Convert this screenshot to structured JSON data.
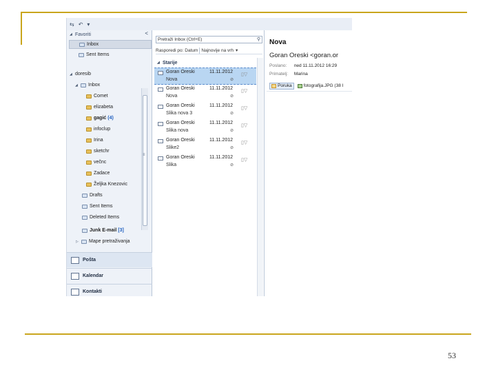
{
  "qat": {
    "icons": [
      "send-receive-icon",
      "undo-icon",
      "customize-icon"
    ],
    "glyphs": [
      "⇆",
      "↶",
      "▾"
    ]
  },
  "nav": {
    "favorites_label": "Favoriti",
    "collapse_glyph": "<",
    "favorites": [
      {
        "label": "Inbox",
        "selected": true
      },
      {
        "label": "Sent Items",
        "selected": false
      }
    ],
    "account_label": "doresib",
    "inbox_label": "Inbox",
    "subfolders": [
      {
        "label": "Comet",
        "count": ""
      },
      {
        "label": "elizabeta",
        "count": ""
      },
      {
        "label": "gagić",
        "count": "(4)"
      },
      {
        "label": "infoclup",
        "count": ""
      },
      {
        "label": "Irina",
        "count": ""
      },
      {
        "label": "sketchr",
        "count": ""
      },
      {
        "label": "večnc",
        "count": ""
      },
      {
        "label": "Zadace",
        "count": ""
      },
      {
        "label": "Željka Knezovic",
        "count": ""
      }
    ],
    "system_folders": [
      {
        "label": "Drafts",
        "count": "",
        "bold": false
      },
      {
        "label": "Sent Items",
        "count": "",
        "bold": false
      },
      {
        "label": "Deleted Items",
        "count": "",
        "bold": false
      },
      {
        "label": "Junk E-mail",
        "count": "[3]",
        "bold": true
      },
      {
        "label": "Mape pretraživanja",
        "count": "",
        "bold": false
      }
    ],
    "buttons": [
      {
        "label": "Pošta",
        "active": true
      },
      {
        "label": "Kalendar",
        "active": false
      },
      {
        "label": "Kontakti",
        "active": false
      }
    ]
  },
  "list": {
    "search_placeholder": "Pretraži Inbox (Ctrl+E)",
    "arrange_by": "Rasporedi po: Datum",
    "sort_order": "Najnovije na vrh",
    "group_label": "Starije",
    "messages": [
      {
        "sender": "Goran Oreski",
        "date": "11.11.2012",
        "subject": "Nova",
        "selected": true
      },
      {
        "sender": "Goran Oreski",
        "date": "11.11.2012",
        "subject": "Nova",
        "selected": false
      },
      {
        "sender": "Goran Oreski",
        "date": "11.11.2012",
        "subject": "Slika nova 3",
        "selected": false
      },
      {
        "sender": "Goran Oreski",
        "date": "11.11.2012",
        "subject": "Slika nova",
        "selected": false
      },
      {
        "sender": "Goran Oreski",
        "date": "11.11.2012",
        "subject": "Slike2",
        "selected": false
      },
      {
        "sender": "Goran Oreski",
        "date": "11.11.2012",
        "subject": "Slika",
        "selected": false
      }
    ]
  },
  "reading": {
    "subject": "Nova",
    "from": "Goran Oreski <goran.or",
    "sent_label": "Poslano:",
    "sent_value": "ned 11.11.2012 16:29",
    "to_label": "Primatelj:",
    "to_value": "Marina",
    "attachments": [
      {
        "label": "Poruka",
        "kind": "message"
      },
      {
        "label": "fotografija.JPG (38 I",
        "kind": "image"
      }
    ]
  },
  "slide_number": "53",
  "colors": {
    "decor_line": "#c9a51c",
    "selection": "#b9d6f2",
    "nav_bg": "#eef2f8"
  }
}
